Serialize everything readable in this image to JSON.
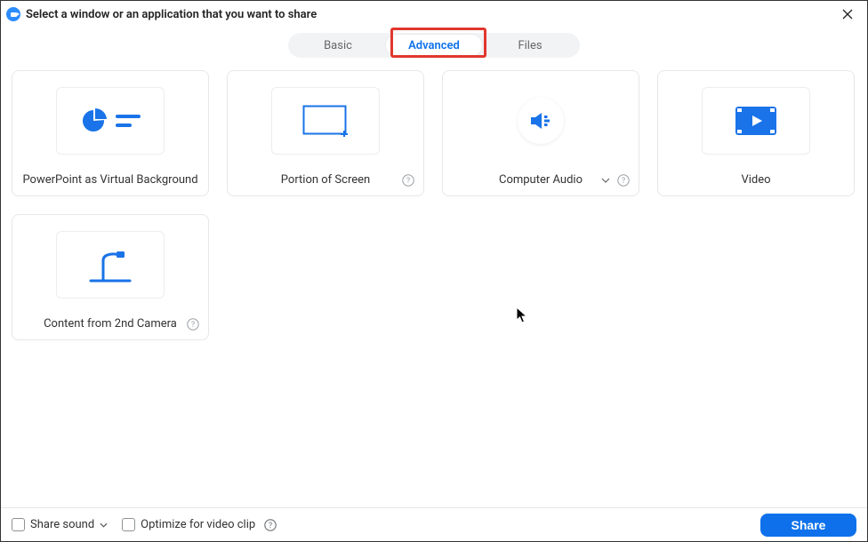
{
  "window": {
    "title": "Select a window or an application that you want to share"
  },
  "tabs": {
    "basic": "Basic",
    "advanced": "Advanced",
    "files": "Files",
    "active": "advanced"
  },
  "cards": {
    "ppt_virtual_bg": "PowerPoint as Virtual Background",
    "portion_of_screen": "Portion of Screen",
    "computer_audio": "Computer Audio",
    "video": "Video",
    "content_2nd_camera": "Content from 2nd Camera"
  },
  "footer": {
    "share_sound": "Share sound",
    "optimize_video": "Optimize for video clip",
    "share_button": "Share"
  },
  "colors": {
    "accent_blue": "#0E71EB",
    "icon_blue": "#1a73e8",
    "highlight_red": "#E1372D"
  }
}
